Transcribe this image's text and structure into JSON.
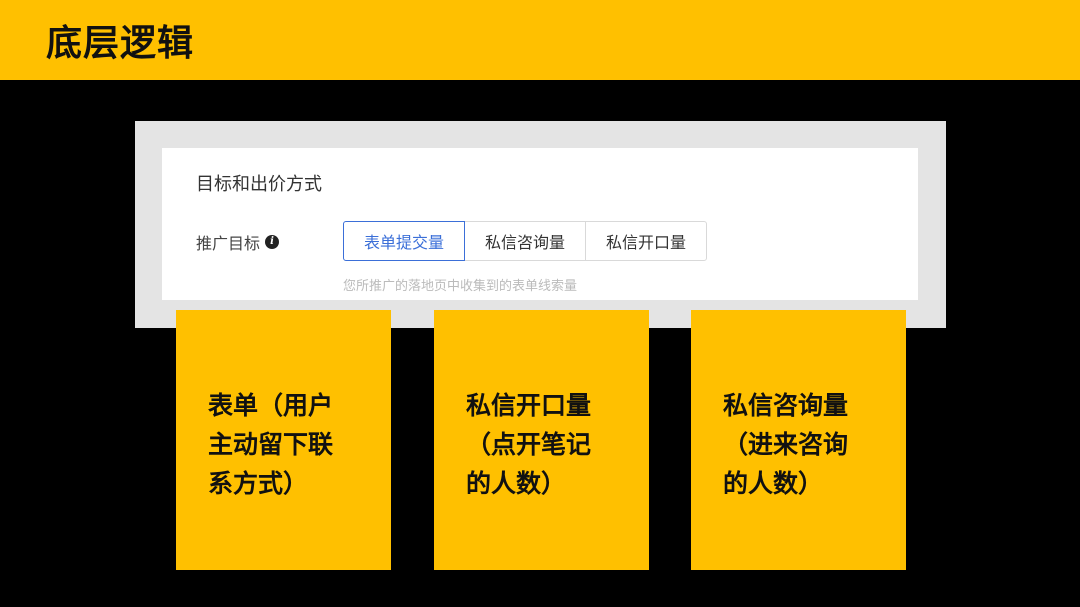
{
  "header": {
    "title": "底层逻辑"
  },
  "panel": {
    "title": "目标和出价方式",
    "row_label": "推广目标",
    "info_icon_glyph": "i",
    "options": [
      {
        "label": "表单提交量",
        "selected": true
      },
      {
        "label": "私信咨询量",
        "selected": false
      },
      {
        "label": "私信开口量",
        "selected": false
      }
    ],
    "hint": "您所推广的落地页中收集到的表单线索量"
  },
  "cards": [
    {
      "text": "表单（用户\n主动留下联\n系方式）"
    },
    {
      "text": "私信开口量\n（点开笔记\n的人数）"
    },
    {
      "text": "私信咨询量\n（进来咨询\n的人数）"
    }
  ],
  "colors": {
    "accent_yellow": "#FFC000",
    "background": "#000000",
    "selected_blue": "#3B6FD8"
  }
}
